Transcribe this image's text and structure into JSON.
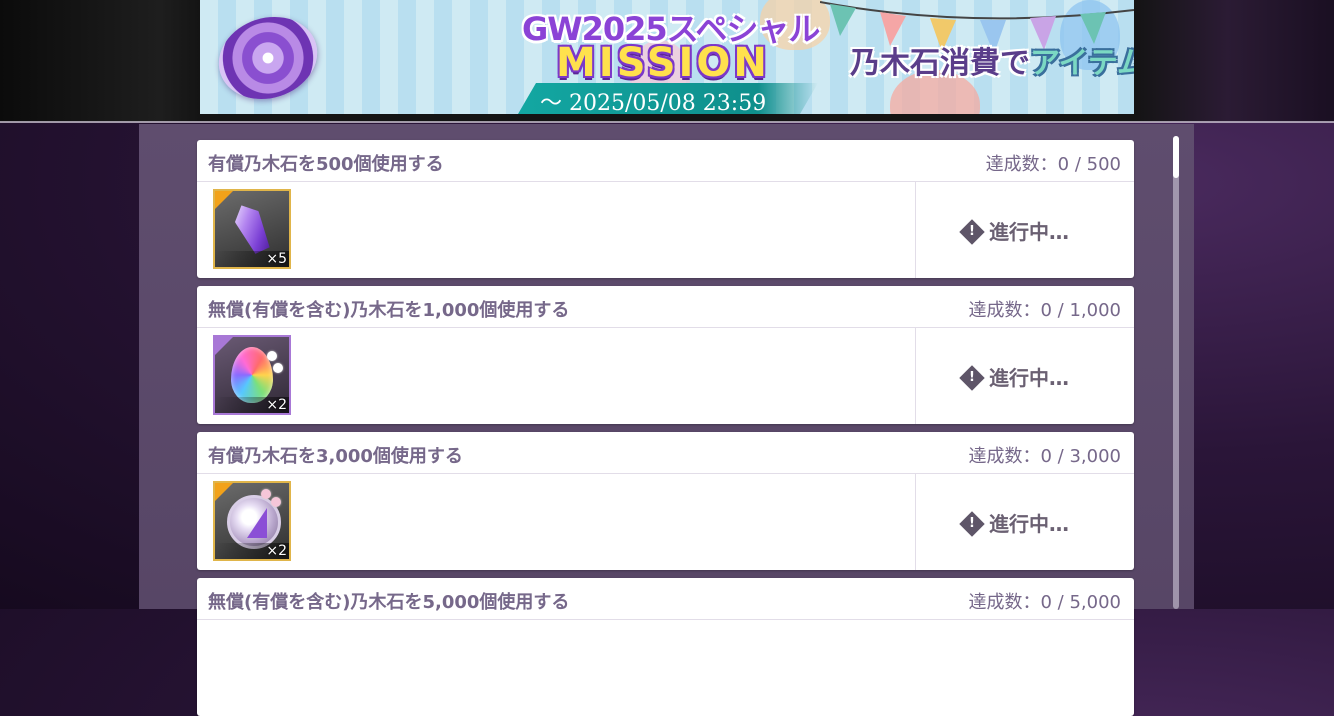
{
  "banner": {
    "title_line1": "GW2025スペシャル",
    "title_line2": "MISSION",
    "deadline": "～ 2025/05/08 23:59",
    "subtitle_part1": "乃木石消費で",
    "subtitle_part2": "アイテムを入手！"
  },
  "missions": [
    {
      "title": "有償乃木石を500個使用する",
      "progress": "達成数：0 / 500",
      "reward": {
        "icon": "purple-crystal-icon",
        "qty": "×5"
      },
      "status": "進行中…"
    },
    {
      "title": "無償(有償を含む)乃木石を1,000個使用する",
      "progress": "達成数：0 / 1,000",
      "reward": {
        "icon": "rainbow-egg-icon",
        "qty": "×2"
      },
      "status": "進行中…"
    },
    {
      "title": "有償乃木石を3,000個使用する",
      "progress": "達成数：0 / 3,000",
      "reward": {
        "icon": "flower-gem-icon",
        "qty": "×2"
      },
      "status": "進行中…"
    },
    {
      "title": "無償(有償を含む)乃木石を5,000個使用する",
      "progress": "達成数：0 / 5,000"
    }
  ],
  "colors": {
    "panel": "#5f4d6e",
    "text": "#76688a",
    "reward_frame_gold": "#e0b54a",
    "reward_frame_purple": "#a878d6"
  }
}
